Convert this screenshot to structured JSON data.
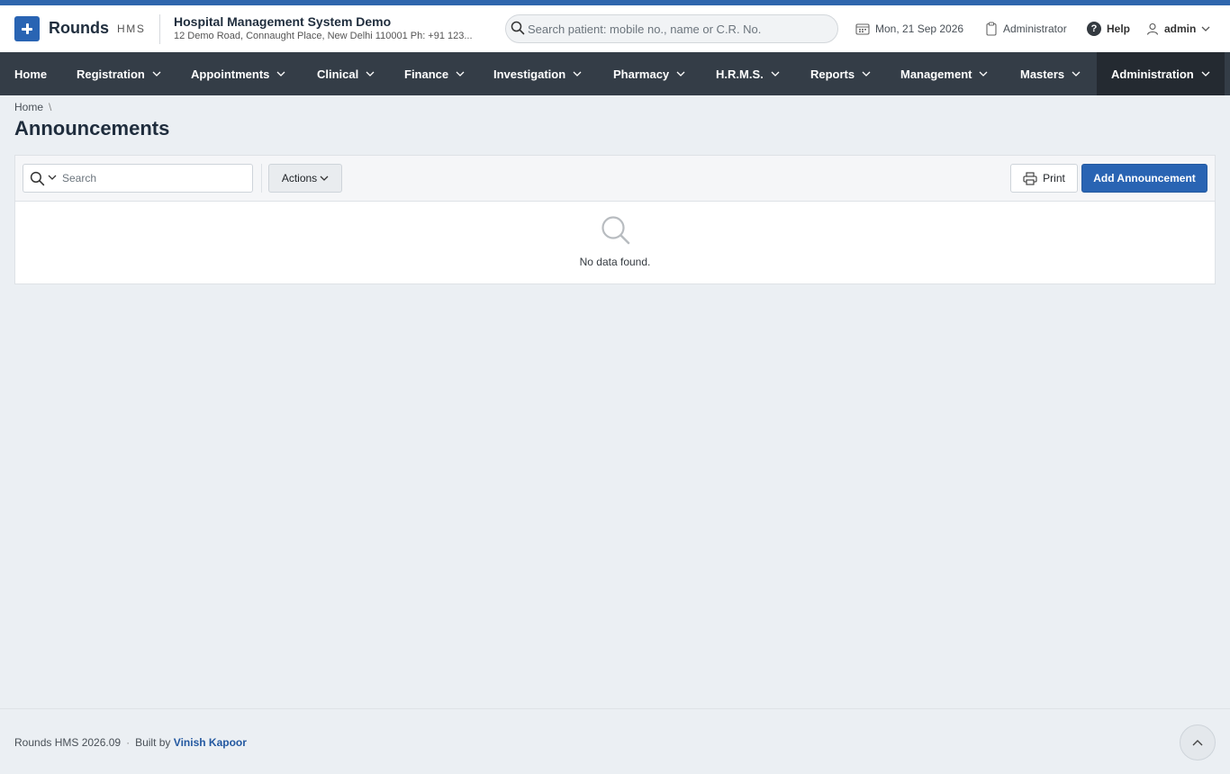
{
  "brand": {
    "name": "Rounds",
    "sub": "HMS"
  },
  "hospital": {
    "name": "Hospital Management System Demo",
    "address": "12 Demo Road, Connaught Place, New Delhi 110001 Ph: +91 123..."
  },
  "search": {
    "placeholder": "Search patient: mobile no., name or C.R. No."
  },
  "header": {
    "date": "Mon, 21 Sep 2026",
    "role": "Administrator",
    "help": "Help",
    "user": "admin"
  },
  "nav": {
    "items": [
      {
        "label": "Home"
      },
      {
        "label": "Registration"
      },
      {
        "label": "Appointments"
      },
      {
        "label": "Clinical"
      },
      {
        "label": "Finance"
      },
      {
        "label": "Investigation"
      },
      {
        "label": "Pharmacy"
      },
      {
        "label": "H.R.M.S."
      },
      {
        "label": "Reports"
      },
      {
        "label": "Management"
      },
      {
        "label": "Masters"
      },
      {
        "label": "Administration"
      }
    ],
    "active": "Administration"
  },
  "breadcrumb": {
    "home": "Home",
    "separator": "\\"
  },
  "page": {
    "title": "Announcements"
  },
  "table": {
    "search_placeholder": "Search",
    "actions_label": "Actions",
    "print_label": "Print",
    "add_label": "Add Announcement",
    "empty_text": "No data found."
  },
  "footer": {
    "version": "Rounds HMS 2026.09",
    "dot": "·",
    "built_by": "Built by",
    "author": "Vinish Kapoor"
  },
  "colors": {
    "accent": "#2964b3",
    "nav_bg": "#343d47",
    "nav_active": "#242a31",
    "page_bg": "#ebeff3"
  }
}
